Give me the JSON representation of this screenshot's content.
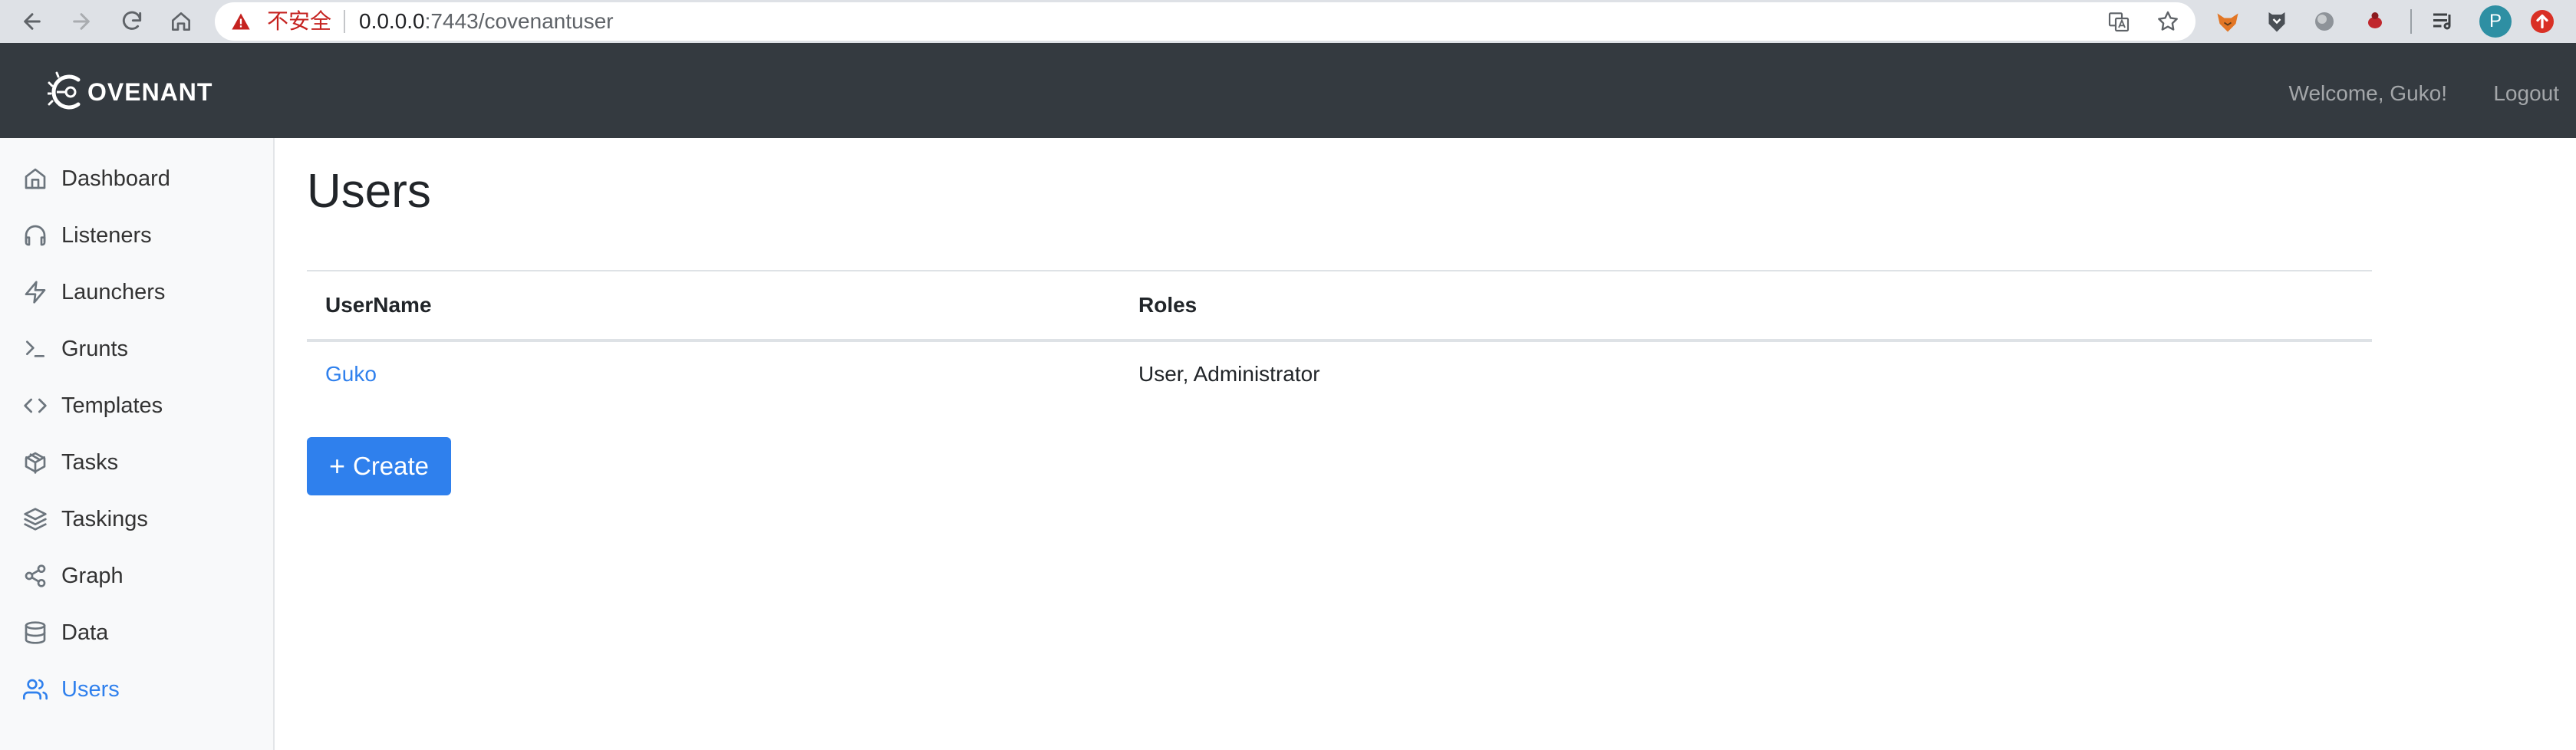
{
  "browser": {
    "insecure_label": "不安全",
    "url_host": "0.0.0.0",
    "url_path": ":7443/covenantuser",
    "avatar_letter": "P"
  },
  "navbar": {
    "brand": "OVENANT",
    "welcome": "Welcome, Guko!",
    "logout": "Logout"
  },
  "sidebar": {
    "items": [
      {
        "label": "Dashboard",
        "icon": "home-icon"
      },
      {
        "label": "Listeners",
        "icon": "headphones-icon"
      },
      {
        "label": "Launchers",
        "icon": "zap-icon"
      },
      {
        "label": "Grunts",
        "icon": "terminal-icon"
      },
      {
        "label": "Templates",
        "icon": "code-icon"
      },
      {
        "label": "Tasks",
        "icon": "package-icon"
      },
      {
        "label": "Taskings",
        "icon": "layers-icon"
      },
      {
        "label": "Graph",
        "icon": "share-icon"
      },
      {
        "label": "Data",
        "icon": "database-icon"
      },
      {
        "label": "Users",
        "icon": "users-icon",
        "active": true
      }
    ]
  },
  "main": {
    "title": "Users",
    "table": {
      "headers": [
        "UserName",
        "Roles"
      ],
      "rows": [
        {
          "username": "Guko",
          "roles": "User, Administrator"
        }
      ]
    },
    "create_label": "Create",
    "create_icon": "+"
  },
  "colors": {
    "accent": "#2f80ed",
    "navbar": "#343a40",
    "sidebar": "#f8f9fa"
  }
}
